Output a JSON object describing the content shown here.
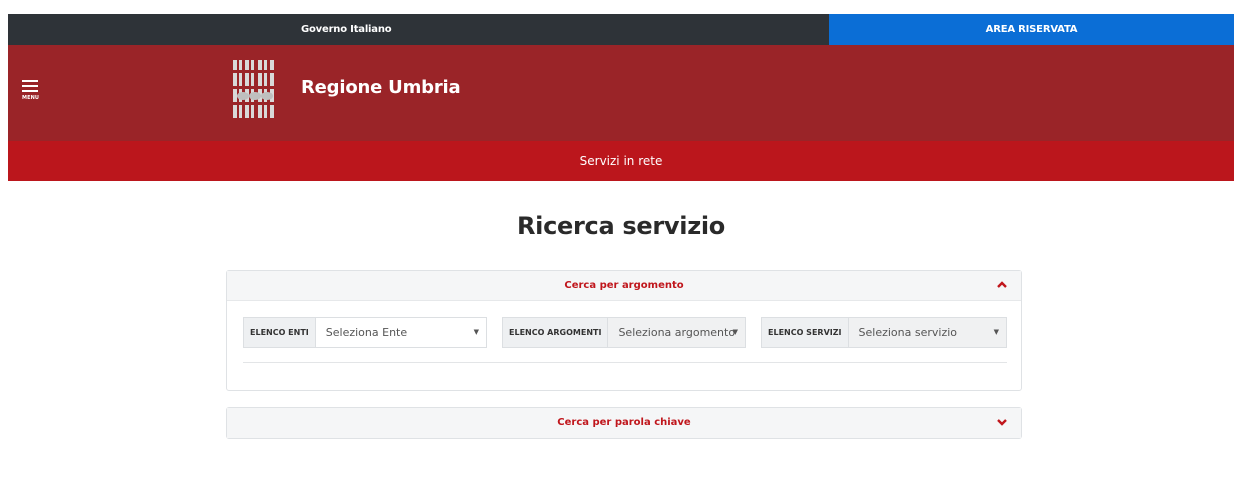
{
  "topbar": {
    "gov_label": "Governo Italiano",
    "area_label": "AREA RISERVATA"
  },
  "header": {
    "menu_label": "MENU",
    "site_title": "Regione Umbria"
  },
  "services_bar": {
    "label": "Servizi in rete"
  },
  "page": {
    "title": "Ricerca servizio"
  },
  "panel_topic": {
    "title": "Cerca per argomento",
    "filters": [
      {
        "label": "ELENCO ENTI",
        "value": "Seleziona Ente",
        "enabled": true
      },
      {
        "label": "ELENCO ARGOMENTI",
        "value": "Seleziona argomento",
        "enabled": false
      },
      {
        "label": "ELENCO SERVIZI",
        "value": "Seleziona servizio",
        "enabled": false
      }
    ],
    "expanded": true
  },
  "panel_keyword": {
    "title": "Cerca per parola chiave",
    "expanded": false
  },
  "colors": {
    "topbar": "#2e3338",
    "area_button": "#0b6ed6",
    "header": "#9a2428",
    "services_bar": "#bb161c",
    "accent_text": "#c0161c"
  },
  "icons": {
    "menu": "hamburger-icon",
    "collapse": "chevron-up-icon",
    "expand": "chevron-down-icon",
    "dropdown": "caret-down-icon"
  }
}
